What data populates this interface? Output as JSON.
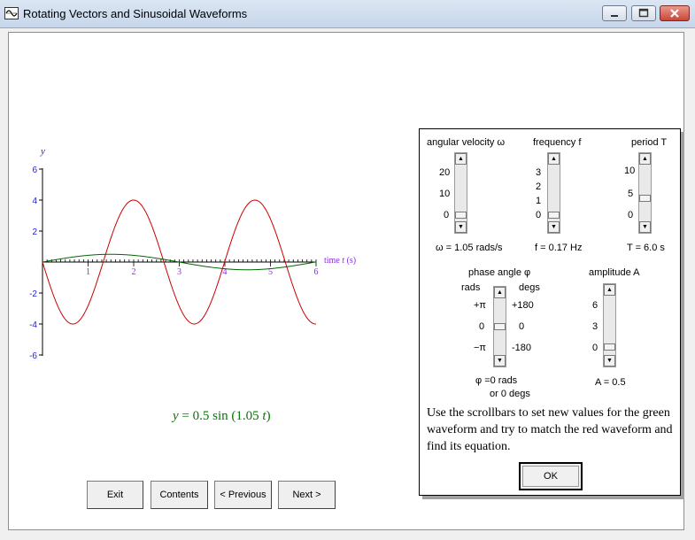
{
  "window": {
    "title": "Rotating Vectors and Sinusoidal Waveforms"
  },
  "graph": {
    "y_label": "y",
    "x_label_prefix": "time ",
    "x_label_var": "t",
    "x_label_suffix": " (s)",
    "y_ticks": [
      "6",
      "4",
      "2",
      "-2",
      "-4",
      "-6"
    ],
    "x_ticks": [
      "1",
      "2",
      "3",
      "4",
      "5",
      "6"
    ],
    "equation": {
      "prefix": "y",
      "body": " = 0.5 sin (1.05 ",
      "var": "t",
      "suffix": ")"
    }
  },
  "chart_data": {
    "type": "line",
    "xlabel": "time t (s)",
    "ylabel": "y",
    "xlim": [
      0,
      6
    ],
    "ylim": [
      -6,
      6
    ],
    "series": [
      {
        "color": "#cc0000",
        "amplitude": 4,
        "omega": 2.36,
        "phase": 3.14159
      },
      {
        "color": "#006600",
        "amplitude": 0.5,
        "omega": 1.05,
        "phase": 0
      }
    ],
    "equation": "y = 0.5 sin (1.05 t)"
  },
  "controls": {
    "angular_velocity": {
      "title": "angular velocity  ω",
      "ticks": [
        "20",
        "10",
        "0"
      ],
      "readout": "ω = 1.05 rads/s",
      "fraction": 0.05
    },
    "frequency": {
      "title": "frequency f",
      "ticks": [
        "3",
        "2",
        "1",
        "0"
      ],
      "readout": "f = 0.17 Hz",
      "fraction": 0.06
    },
    "period": {
      "title": "period T",
      "ticks": [
        "10",
        "5",
        "0"
      ],
      "readout": "T = 6.0 s",
      "fraction": 0.4
    },
    "phase": {
      "title": "phase angle  φ",
      "rads_label": "rads",
      "degs_label": "degs",
      "rad_ticks": [
        "+π",
        "0",
        "−π"
      ],
      "deg_ticks": [
        "+180",
        "0",
        "-180"
      ],
      "readout_1": "φ =0 rads",
      "readout_2": "or 0 degs",
      "fraction": 0.5
    },
    "amplitude": {
      "title": "amplitude A",
      "ticks": [
        "6",
        "3",
        "0"
      ],
      "readout": "A = 0.5",
      "fraction": 0.08
    }
  },
  "instructions": "Use the scrollbars to set new values for the green waveform and try to match the red waveform and find its equation.",
  "ok_label": "OK",
  "nav": {
    "exit": "Exit",
    "contents": "Contents",
    "previous": "< Previous",
    "next": "Next >"
  }
}
